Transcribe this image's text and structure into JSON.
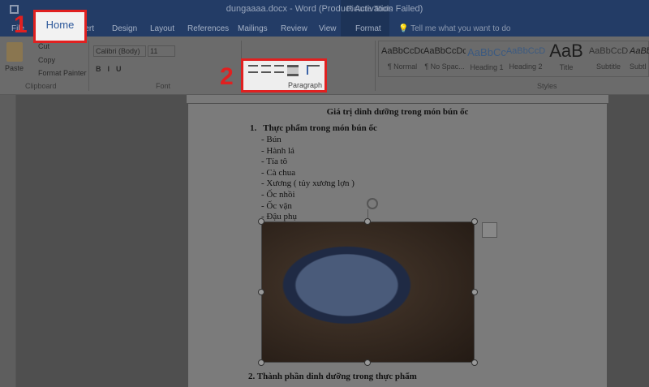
{
  "window": {
    "title": "dungaaaa.docx - Word (Product Activation Failed)",
    "context_tab": "Picture Tools"
  },
  "tabs": [
    "File",
    "Home",
    "Insert",
    "Design",
    "Layout",
    "References",
    "Mailings",
    "Review",
    "View",
    "Format"
  ],
  "tell_me": "Tell me what you want to do",
  "clipboard": {
    "paste": "Paste",
    "cut": "Cut",
    "copy": "Copy",
    "format_painter": "Format Painter",
    "group": "Clipboard"
  },
  "font": {
    "name": "Calibri (Body)",
    "size": "11",
    "group": "Font"
  },
  "paragraph": {
    "group": "Paragraph"
  },
  "styles": {
    "group": "Styles",
    "items": [
      {
        "sample": "AaBbCcDc",
        "name": "¶ Normal"
      },
      {
        "sample": "AaBbCcDc",
        "name": "¶ No Spac..."
      },
      {
        "sample": "AaBbCc",
        "name": "Heading 1"
      },
      {
        "sample": "AaBbCcD",
        "name": "Heading 2"
      },
      {
        "sample": "AaB",
        "name": "Title"
      },
      {
        "sample": "AaBbCcD",
        "name": "Subtitle"
      },
      {
        "sample": "AaBb",
        "name": "Subtl"
      }
    ]
  },
  "annotations": {
    "step1": "1",
    "step2": "2"
  },
  "document": {
    "heading": "Giá trị dinh dưỡng trong món bún ốc",
    "section1": "1.   Thực phẩm trong món bún ốc",
    "items": [
      "- Bún",
      "- Hành lá",
      "- Tía tô",
      "- Cà chua",
      "- Xương ( tủy xương lợn )",
      "- Ốc nhồi",
      "- Ốc vặn",
      "- Đậu phụ"
    ],
    "section2": "2. Thành phần dinh dưỡng trong thực phẩm"
  },
  "colors": {
    "highlight": "#e02020",
    "title_bar": "#2b579a"
  }
}
